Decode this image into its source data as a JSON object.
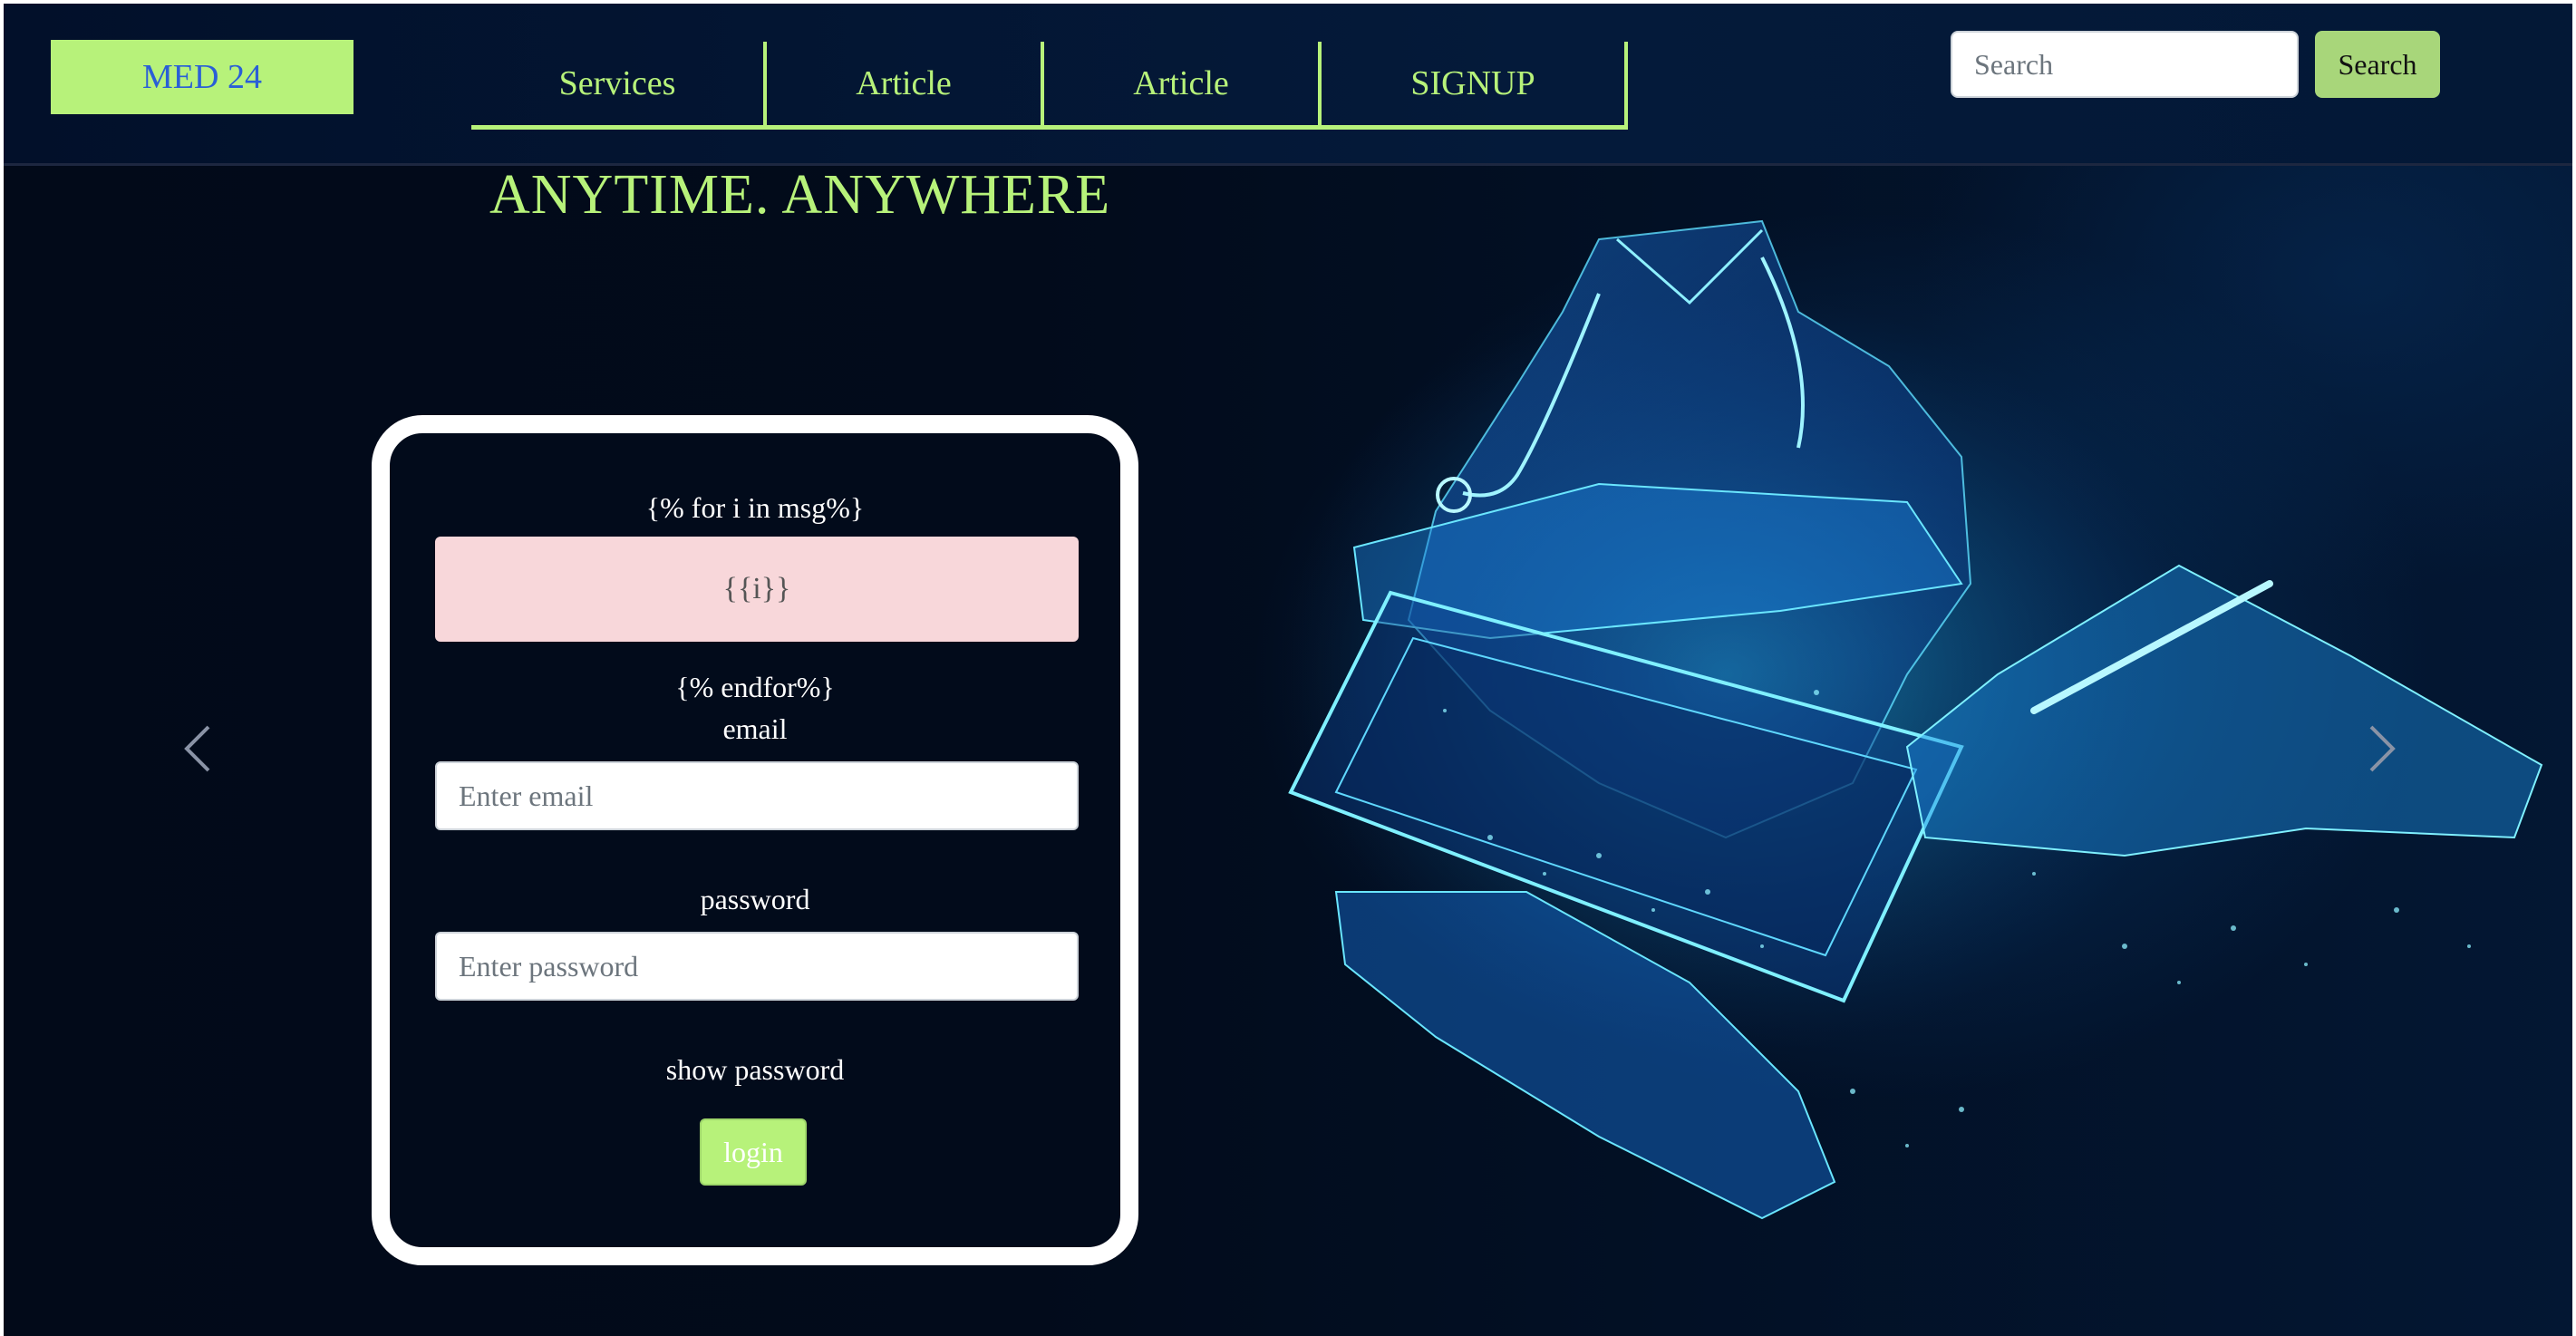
{
  "brand": {
    "name": "MED 24"
  },
  "nav": {
    "items": [
      {
        "label": "Services"
      },
      {
        "label": "Article"
      },
      {
        "label": "Article"
      },
      {
        "label": "SIGNUP"
      }
    ]
  },
  "search": {
    "placeholder": "Search",
    "button_label": "Search"
  },
  "hero": {
    "tagline": "ANYTIME. ANYWHERE",
    "accent_color": "#b7f27a",
    "illustration": "doctor-with-tablet-wireframe-illustration"
  },
  "login_form": {
    "loop_start": "{% for i in msg%}",
    "message_placeholder": "{{i}}",
    "loop_end": "{% endfor%}",
    "email_label": "email",
    "email_placeholder": "Enter email",
    "password_label": "password",
    "password_placeholder": "Enter password",
    "show_password_label": "show password",
    "login_button": "login"
  },
  "carousel": {
    "prev_icon": "chevron-left-icon",
    "next_icon": "chevron-right-icon"
  }
}
